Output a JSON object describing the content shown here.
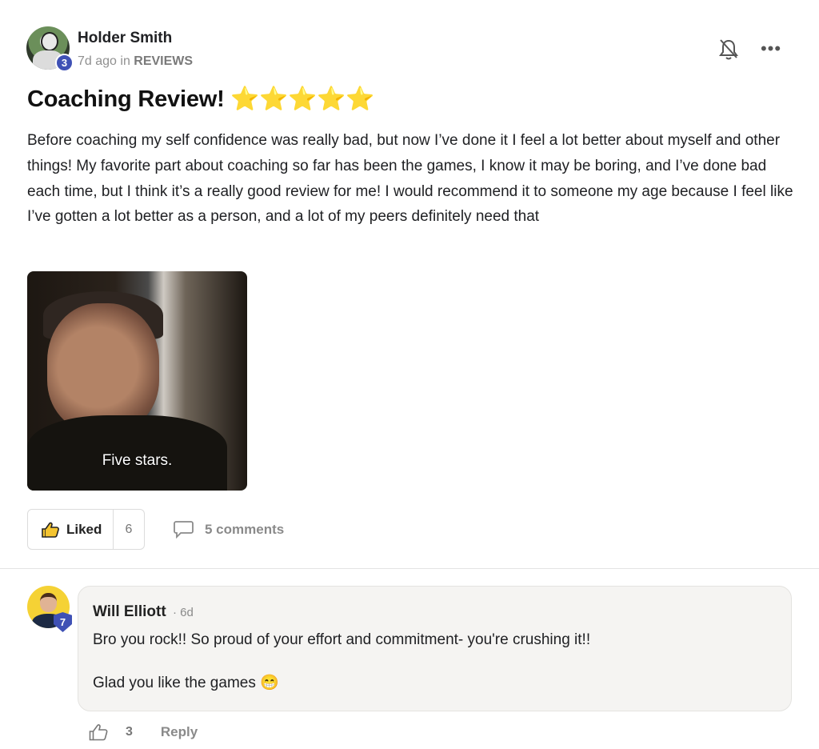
{
  "post": {
    "author": "Holder Smith",
    "level": "3",
    "time": "7d ago",
    "in_word": " in ",
    "category": "REVIEWS",
    "title": "Coaching Review! ⭐⭐⭐⭐⭐",
    "body": "Before coaching my self confidence was really bad, but now I’ve done it I feel a lot better about myself and other things! My favorite part about coaching so far has been the games, I know it may be boring, and I’ve done bad each time, but I think it’s a really good review for me! I would recommend it to someone my age because I feel like I’ve gotten a lot better as a person, and a lot of my peers definitely need that",
    "media_caption": "Five stars.",
    "like_label": "Liked",
    "like_count": "6",
    "comments_label": "5 comments"
  },
  "comment": {
    "author": "Will Elliott",
    "level": "7",
    "time": "· 6d",
    "line1": "Bro you rock!! So proud of your effort and commitment- you're crushing it!!",
    "line2": "Glad you like the games 😁",
    "like_count": "3",
    "reply_label": "Reply"
  },
  "icons": {
    "bell": "bell-off-icon",
    "more": "more-horizontal-icon",
    "thumbs_up": "thumbs-up-icon",
    "comment": "comment-bubble-icon"
  },
  "colors": {
    "badge": "#3f51b5",
    "muted": "#8a8a8a"
  }
}
